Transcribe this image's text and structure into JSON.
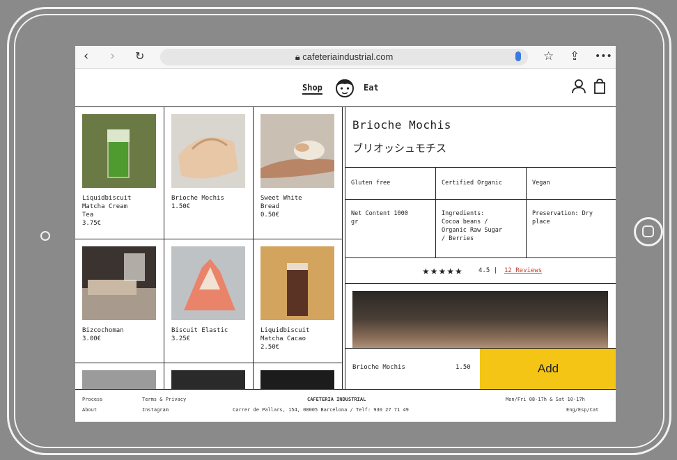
{
  "browser": {
    "url": "cafeteriaindustrial.com",
    "icons": [
      "back-icon",
      "forward-icon",
      "reload-icon",
      "lock-icon",
      "mic-icon",
      "star-icon",
      "share-icon",
      "more-icon"
    ]
  },
  "header": {
    "nav_shop": "Shop",
    "nav_eat": "Eat"
  },
  "products": [
    {
      "name": "Liquidbiscuit\nMatcha Cream\nTea",
      "price": "3.75€"
    },
    {
      "name": "Brioche Mochis",
      "price": "1.50€"
    },
    {
      "name": "Sweet White\nBread",
      "price": "0.50€"
    },
    {
      "name": "Bizcochoman",
      "price": "3.00€"
    },
    {
      "name": "Biscuit Elastic",
      "price": "3.25€"
    },
    {
      "name": "Liquidbiscuit\nMatcha Cacao",
      "price": "2.50€"
    }
  ],
  "detail": {
    "title": "Brioche Mochis",
    "title_jp": "ブリオッシュモチス",
    "attributes": [
      "Gluten free",
      "Certified Organic",
      "Vegan"
    ],
    "net_content": "Net Content 1000\ngr",
    "ingredients": "Ingredients:\nCocoa beans /\nOrganic Raw Sugar\n/ Berries",
    "preservation": "Preservation: Dry\nplace",
    "rating_score": "4.5",
    "rating_sep": "|",
    "reviews_link": "12 Reviews",
    "stars": "★★★★★"
  },
  "buy": {
    "name": "Brioche Mochis",
    "price": "1.50",
    "add_label": "Add"
  },
  "footer": {
    "process": "Process",
    "about": "About",
    "terms": "Terms & Privacy",
    "instagram": "Instagram",
    "brand": "CAFETERIA INDUSTRIAL",
    "address": "Carrer de Pallars, 154, 08005 Barcelona / Telf: 930 27 71 49",
    "hours": "Mon/Fri 08-17h & Sat 10-17h",
    "languages": "Eng/Esp/Cat"
  },
  "colors": {
    "accent": "#f4c514",
    "link": "#c0392b",
    "device": "#8a8a8a"
  }
}
